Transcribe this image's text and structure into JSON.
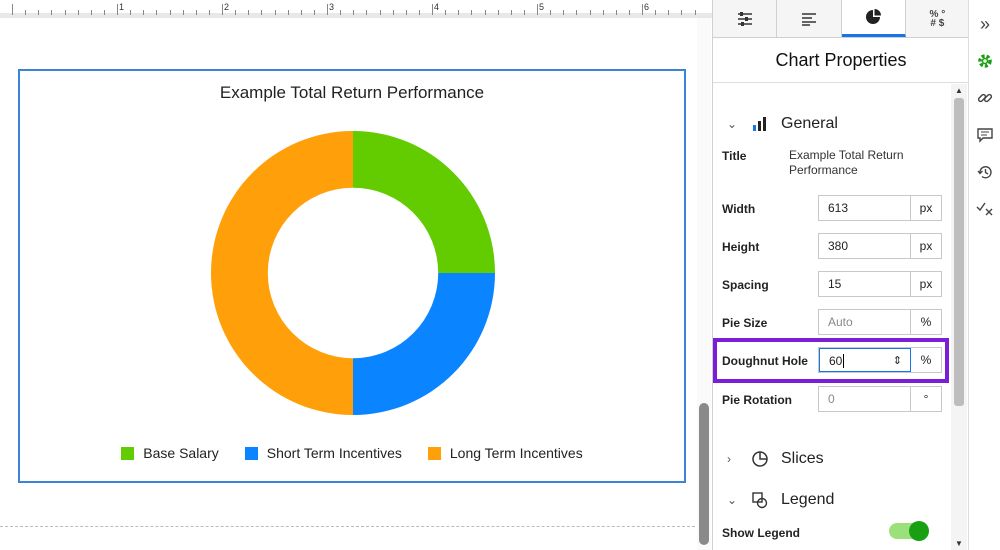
{
  "ruler": {
    "numbers": [
      "1",
      "2",
      "3",
      "4",
      "5",
      "6"
    ]
  },
  "chart_data": {
    "type": "pie",
    "title": "Example Total Return Performance",
    "doughnut_hole_percent": 60,
    "slices": [
      {
        "label": "Base Salary",
        "value": 25,
        "color": "#62cc00"
      },
      {
        "label": "Short Term Incentives",
        "value": 25,
        "color": "#0a84ff"
      },
      {
        "label": "Long Term Incentives",
        "value": 50,
        "color": "#ff9f0a"
      }
    ],
    "legend_position": "bottom"
  },
  "panel": {
    "tabs": [
      {
        "icon": "sliders-icon"
      },
      {
        "icon": "text-align-icon"
      },
      {
        "icon": "pie-chart-icon"
      },
      {
        "icon": "percent-hash-icon",
        "text": "%\n#$"
      }
    ],
    "title": "Chart Properties",
    "general": {
      "label": "General",
      "title_label": "Title",
      "title_value": "Example Total Return Performance",
      "width_label": "Width",
      "width_value": "613",
      "width_unit": "px",
      "height_label": "Height",
      "height_value": "380",
      "height_unit": "px",
      "spacing_label": "Spacing",
      "spacing_value": "15",
      "spacing_unit": "px",
      "pie_size_label": "Pie Size",
      "pie_size_placeholder": "Auto",
      "pie_size_unit": "%",
      "doughnut_label": "Doughnut Hole",
      "doughnut_value": "60",
      "doughnut_unit": "%",
      "rotation_label": "Pie Rotation",
      "rotation_placeholder": "0",
      "rotation_unit": "°"
    },
    "slices_label": "Slices",
    "legend_label": "Legend",
    "show_legend_label": "Show Legend",
    "show_legend_on": true
  },
  "rail": {
    "collapse": "»",
    "icons": [
      "gear-icon",
      "link-icon",
      "comment-icon",
      "history-icon",
      "check-x-icon"
    ]
  },
  "colors": {
    "accent": "#1a73e8",
    "highlight": "#7a1fd6",
    "toggle": "#18a012"
  }
}
